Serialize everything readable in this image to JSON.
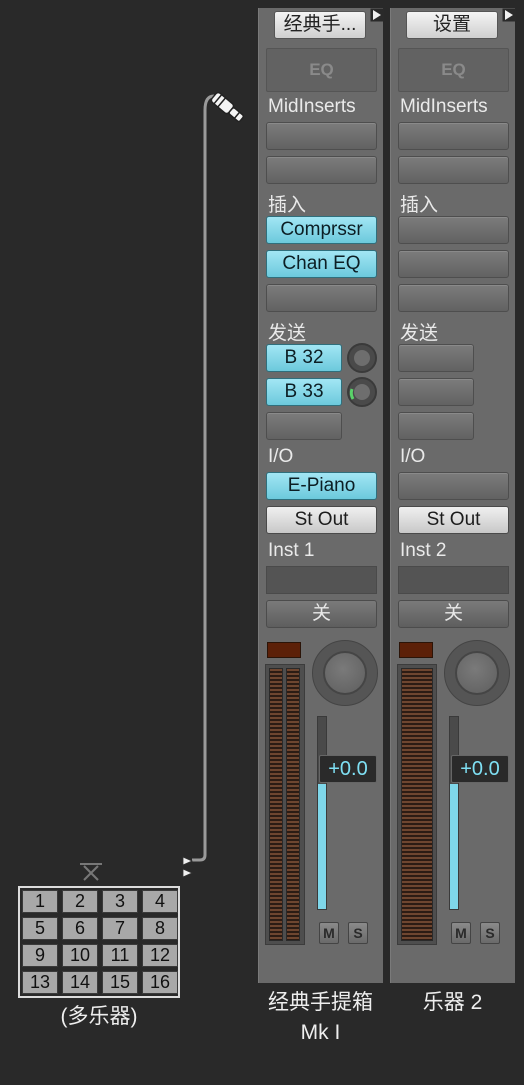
{
  "multi_instrument": {
    "label": "(多乐器)",
    "channels": [
      "1",
      "2",
      "3",
      "4",
      "5",
      "6",
      "7",
      "8",
      "9",
      "10",
      "11",
      "12",
      "13",
      "14",
      "15",
      "16"
    ]
  },
  "strips": [
    {
      "setting": "经典手...",
      "eq_label": "EQ",
      "midi_inserts_label": "MidInserts",
      "inserts_label": "插入",
      "inserts": [
        "Comprssr",
        "Chan EQ"
      ],
      "sends_label": "发送",
      "sends": [
        "B 32",
        "B 33"
      ],
      "io_label": "I/O",
      "input": "E-Piano",
      "output": "St Out",
      "automation_label": "Inst 1",
      "group_label": "关",
      "volume": "+0.0",
      "mute": "M",
      "solo": "S",
      "name_line1": "经典手提箱",
      "name_line2": "Mk I"
    },
    {
      "setting": "设置",
      "eq_label": "EQ",
      "midi_inserts_label": "MidInserts",
      "inserts_label": "插入",
      "sends_label": "发送",
      "io_label": "I/O",
      "output": "St Out",
      "automation_label": "Inst 2",
      "group_label": "关",
      "volume": "+0.0",
      "mute": "M",
      "solo": "S",
      "name_line1": "乐器 2"
    }
  ],
  "colors": {
    "active_slot": "#7fd7ea",
    "strip_bg": "#6a6a6a",
    "background": "#292929"
  }
}
